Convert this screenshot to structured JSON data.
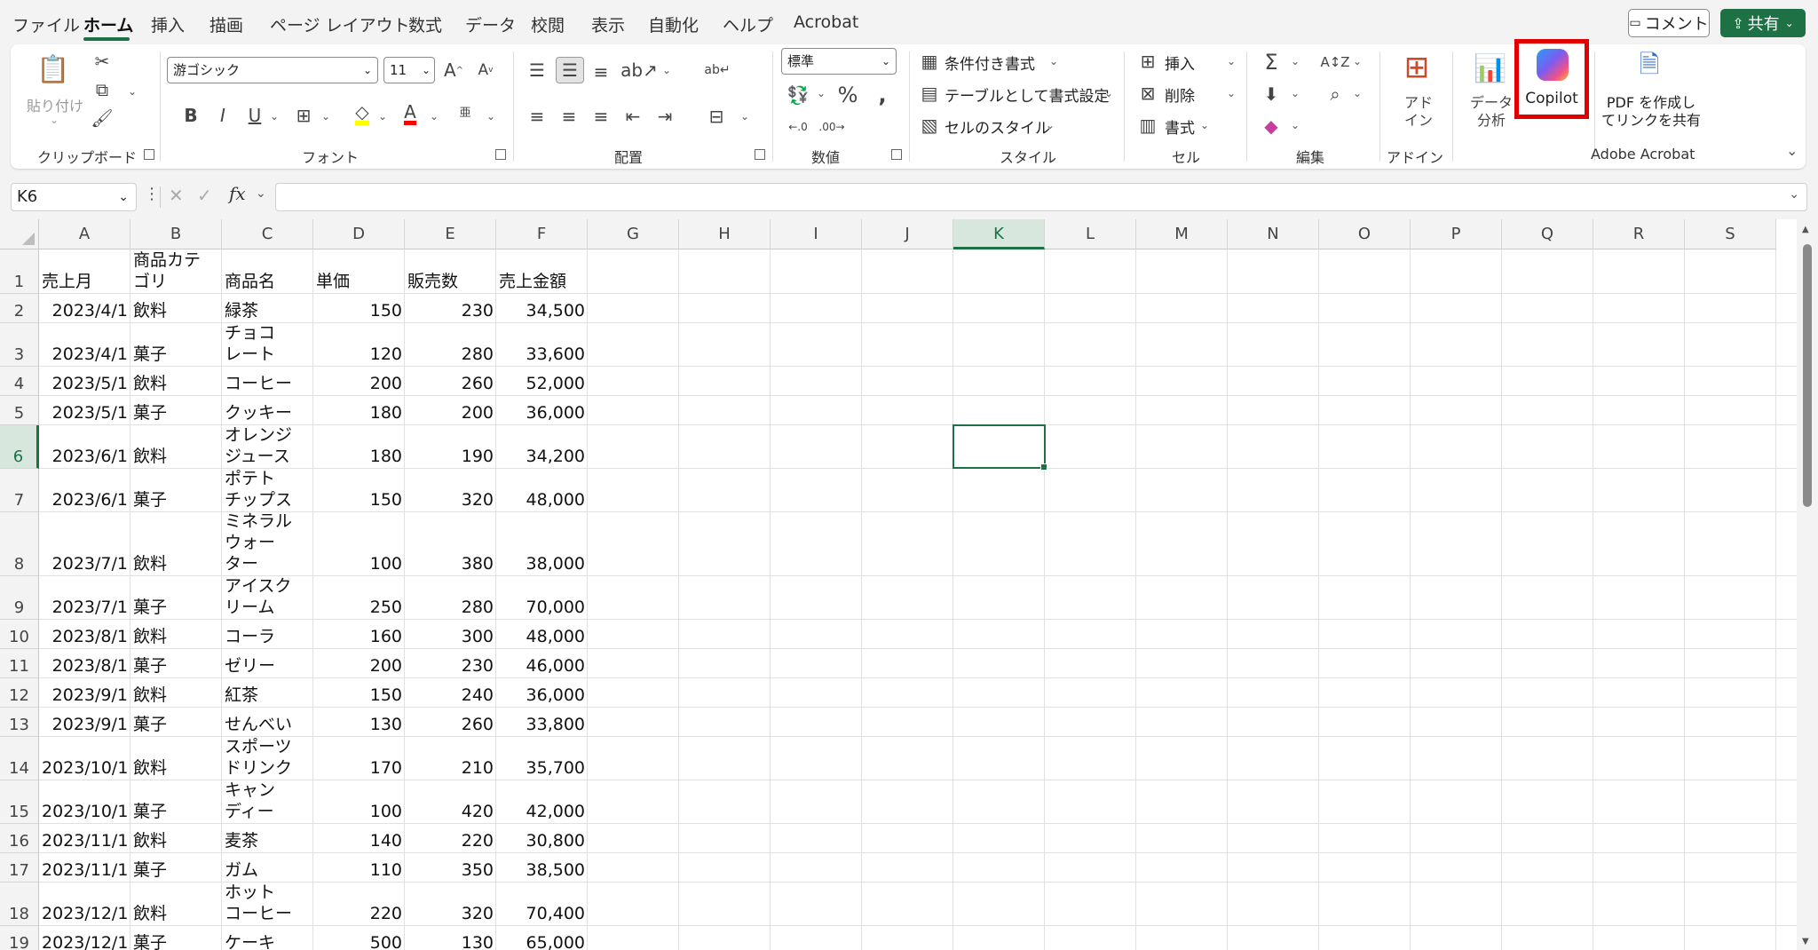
{
  "menu": {
    "tabs": [
      "ファイル",
      "ホーム",
      "挿入",
      "描画",
      "ページ レイアウト",
      "数式",
      "データ",
      "校閲",
      "表示",
      "自動化",
      "ヘルプ",
      "Acrobat"
    ],
    "active_tab": "ホーム",
    "comment_label": "コメント",
    "share_label": "共有"
  },
  "ribbon": {
    "clipboard": {
      "paste_label": "貼り付け",
      "group": "クリップボード"
    },
    "font": {
      "name": "游ゴシック",
      "size": "11",
      "group": "フォント",
      "highlight_color": "#ffff00",
      "font_color": "#ff0000"
    },
    "alignment": {
      "group": "配置"
    },
    "number": {
      "format": "標準",
      "group": "数値"
    },
    "styles": {
      "conditional": "条件付き書式",
      "table": "テーブルとして書式設定",
      "cell_style": "セルのスタイル",
      "group": "スタイル"
    },
    "cells": {
      "insert": "挿入",
      "delete": "削除",
      "format": "書式",
      "group": "セル"
    },
    "editing": {
      "group": "編集"
    },
    "addins": {
      "label": "アド\nイン",
      "group": "アドイン"
    },
    "data_analysis": {
      "label": "データ\n分析"
    },
    "copilot": {
      "label": "Copilot"
    },
    "acrobat": {
      "label": "PDF を作成し\nてリンクを共有",
      "group": "Adobe Acrobat"
    }
  },
  "formula_bar": {
    "name_box": "K6",
    "fx": "fx",
    "content": ""
  },
  "sheet": {
    "columns": [
      "A",
      "B",
      "C",
      "D",
      "E",
      "F",
      "G",
      "H",
      "I",
      "J",
      "K",
      "L",
      "M",
      "N",
      "O",
      "P",
      "Q",
      "R",
      "S"
    ],
    "selected_column": "K",
    "selected_row": "6",
    "rows": [
      {
        "n": "1",
        "cells": [
          "売上月",
          "商品カテ\nゴリ",
          "商品名",
          "単価",
          "販売数",
          "売上金額"
        ]
      },
      {
        "n": "2",
        "cells": [
          "2023/4/1",
          "飲料",
          "緑茶",
          "150",
          "230",
          "34,500"
        ]
      },
      {
        "n": "3",
        "cells": [
          "2023/4/1",
          "菓子",
          "チョコ\nレート",
          "120",
          "280",
          "33,600"
        ]
      },
      {
        "n": "4",
        "cells": [
          "2023/5/1",
          "飲料",
          "コーヒー",
          "200",
          "260",
          "52,000"
        ]
      },
      {
        "n": "5",
        "cells": [
          "2023/5/1",
          "菓子",
          "クッキー",
          "180",
          "200",
          "36,000"
        ]
      },
      {
        "n": "6",
        "cells": [
          "2023/6/1",
          "飲料",
          "オレンジ\nジュース",
          "180",
          "190",
          "34,200"
        ]
      },
      {
        "n": "7",
        "cells": [
          "2023/6/1",
          "菓子",
          "ポテト\nチップス",
          "150",
          "320",
          "48,000"
        ]
      },
      {
        "n": "8",
        "cells": [
          "2023/7/1",
          "飲料",
          "ミネラル\nウォー\nター",
          "100",
          "380",
          "38,000"
        ]
      },
      {
        "n": "9",
        "cells": [
          "2023/7/1",
          "菓子",
          "アイスク\nリーム",
          "250",
          "280",
          "70,000"
        ]
      },
      {
        "n": "10",
        "cells": [
          "2023/8/1",
          "飲料",
          "コーラ",
          "160",
          "300",
          "48,000"
        ]
      },
      {
        "n": "11",
        "cells": [
          "2023/8/1",
          "菓子",
          "ゼリー",
          "200",
          "230",
          "46,000"
        ]
      },
      {
        "n": "12",
        "cells": [
          "2023/9/1",
          "飲料",
          "紅茶",
          "150",
          "240",
          "36,000"
        ]
      },
      {
        "n": "13",
        "cells": [
          "2023/9/1",
          "菓子",
          "せんべい",
          "130",
          "260",
          "33,800"
        ]
      },
      {
        "n": "14",
        "cells": [
          "2023/10/1",
          "飲料",
          "スポーツ\nドリンク",
          "170",
          "210",
          "35,700"
        ]
      },
      {
        "n": "15",
        "cells": [
          "2023/10/1",
          "菓子",
          "キャン\nディー",
          "100",
          "420",
          "42,000"
        ]
      },
      {
        "n": "16",
        "cells": [
          "2023/11/1",
          "飲料",
          "麦茶",
          "140",
          "220",
          "30,800"
        ]
      },
      {
        "n": "17",
        "cells": [
          "2023/11/1",
          "菓子",
          "ガム",
          "110",
          "350",
          "38,500"
        ]
      },
      {
        "n": "18",
        "cells": [
          "2023/12/1",
          "飲料",
          "ホット\nコーヒー",
          "220",
          "320",
          "70,400"
        ]
      },
      {
        "n": "19",
        "cells": [
          "2023/12/1",
          "菓子",
          "ケーキ",
          "500",
          "130",
          "65,000"
        ]
      }
    ]
  },
  "colors": {
    "accent": "#1e7145",
    "highlight_box": "#e00000"
  }
}
